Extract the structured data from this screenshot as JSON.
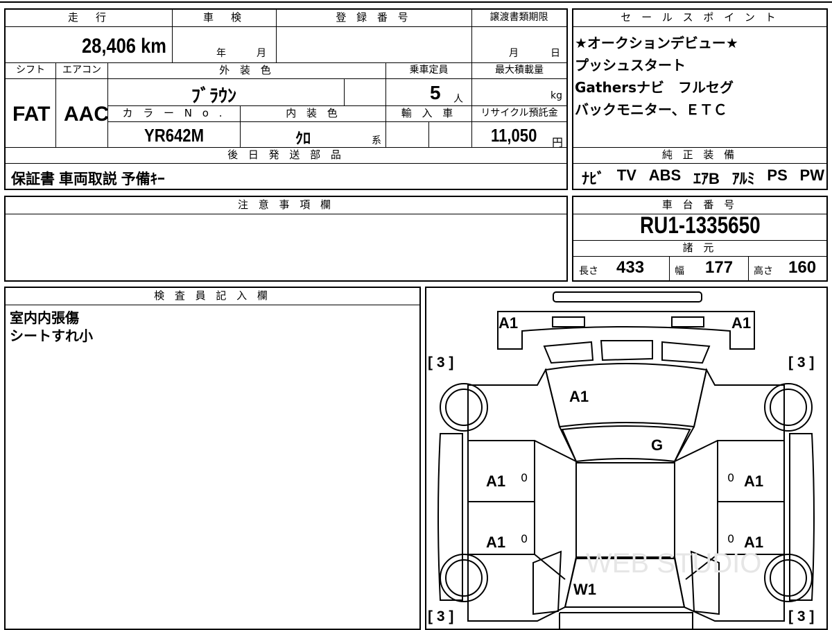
{
  "top_box": {
    "headers": {
      "mileage": "走　行",
      "inspection": "車　検",
      "registration": "登 録 番 号",
      "transfer_deadline": "譲渡書類期限",
      "shift": "シフト",
      "aircon": "エアコン",
      "exterior_color": "外 装 色",
      "capacity": "乗車定員",
      "max_load": "最大積載量",
      "color_no": "カ ラ ー N o .",
      "interior_color": "内 装 色",
      "import": "輸 入 車",
      "recycle": "リサイクル預託金",
      "later_parts": "後 日 発 送 部 品"
    },
    "mileage_value": "28,406",
    "mileage_unit": "km",
    "inspection_year": "年",
    "inspection_month": "月",
    "deadline_month": "月",
    "deadline_day": "日",
    "shift_value": "FAT",
    "aircon_value": "AAC",
    "exterior_value": "ﾌﾞﾗｳﾝ",
    "capacity_value": "5",
    "capacity_unit": "人",
    "max_load_unit": "kg",
    "color_no_value": "YR642M",
    "interior_value": "ｸﾛ",
    "interior_suffix": "系",
    "recycle_value": "11,050",
    "recycle_unit": "円",
    "later_parts_value": "保証書 車両取説 予備ｷｰ"
  },
  "sales_box": {
    "header": "セ ー ル ス ポ イ ン ト",
    "lines": [
      "★オークションデビュー★",
      "プッシュスタート",
      "Gathersナビ　フルセグ",
      "バックモニター、ＥＴＣ"
    ],
    "equipment_header": "純 正 装 備",
    "equipment": [
      "ﾅﾋﾞ",
      "TV",
      "ABS",
      "ｴｱB",
      "ｱﾙﾐ",
      "PS",
      "PW"
    ]
  },
  "notes_box": {
    "header": "注 意 事 項 欄",
    "text": ""
  },
  "chassis_box": {
    "header": "車 台 番 号",
    "value": "RU1-1335650",
    "spec_header": "諸 元",
    "length_label": "長さ",
    "length_value": "433",
    "width_label": "幅",
    "width_value": "177",
    "height_label": "高さ",
    "height_value": "160"
  },
  "inspector_box": {
    "header": "検 査 員 記 入 欄",
    "lines": [
      "室内内張傷",
      "シートすれ小"
    ]
  },
  "diagram": {
    "labels": {
      "front_left": "A1",
      "front_right": "A1",
      "hood": "A1",
      "windshield": "G",
      "front_door_left": "A1",
      "front_door_right": "A1",
      "rear_door_left": "A1",
      "rear_door_right": "A1",
      "rear_glass": "W1",
      "tire_tl": "[ 3 ]",
      "tire_tr": "[ 3 ]",
      "tire_bl": "[ 3 ]",
      "tire_br": "[ 3 ]",
      "door_mark": "0",
      "watermark": "WEB STUDIO"
    }
  }
}
